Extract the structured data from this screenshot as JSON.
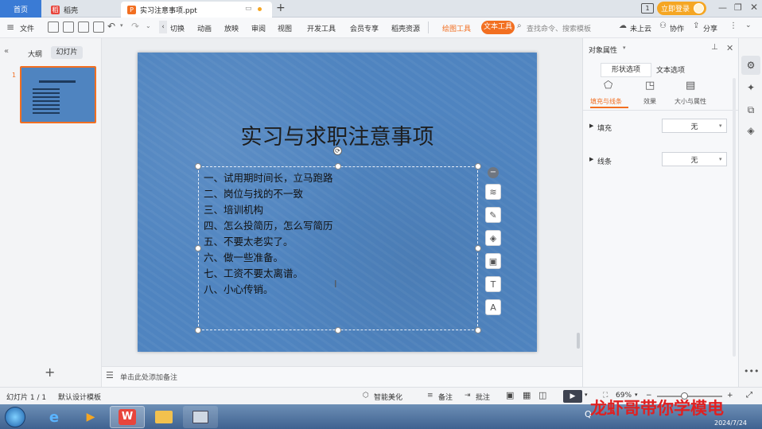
{
  "titlebar": {
    "tabs": [
      {
        "label": "首页"
      },
      {
        "label": "稻壳",
        "icon": "daoke-icon"
      },
      {
        "label": "实习注意事项.ppt",
        "icon": "ppt-icon"
      }
    ],
    "new_tab": "+",
    "window_badge": "1",
    "login_button": "立即登录"
  },
  "menubar": {
    "file": "文件",
    "items": [
      "切换",
      "动画",
      "放映",
      "审阅",
      "视图",
      "开发工具",
      "会员专享",
      "稻壳资源"
    ],
    "drawing_tools": "绘图工具",
    "text_tools": "文本工具",
    "search_placeholder": "查找命令、搜索模板",
    "cloud": "未上云",
    "collab": "协作",
    "share": "分享"
  },
  "leftpanel": {
    "tab_outline": "大纲",
    "tab_slides": "幻灯片",
    "slide_number": "1",
    "add_label": "+"
  },
  "slide": {
    "title": "实习与求职注意事项",
    "bullets": [
      "一、试用期时间长，立马跑路",
      "二、岗位与找的不一致",
      "三、培训机构",
      "四、怎么投简历，怎么写简历",
      "五、不要太老实了。",
      "六、做一些准备。",
      "七、工资不要太离谱。",
      "八、小心传销。"
    ]
  },
  "notes": {
    "placeholder": "单击此处添加备注"
  },
  "rightpanel": {
    "title": "对象属性",
    "tab_shape": "形状选项",
    "tab_text": "文本选项",
    "sub_fill_line": "填充与线条",
    "sub_effects": "效果",
    "sub_size": "大小与属性",
    "fill_label": "填充",
    "fill_value": "无",
    "line_label": "线条",
    "line_value": "无"
  },
  "statusbar": {
    "slide_count": "幻灯片 1 / 1",
    "template": "默认设计模板",
    "smart_beautify": "智能美化",
    "notes": "备注",
    "comments": "批注",
    "zoom": "69%"
  },
  "taskbar": {
    "date": "2024/7/24"
  },
  "watermark": "龙虾哥带你学模电",
  "colors": {
    "accent_blue": "#3a7bd5",
    "orange": "#f5a623",
    "slide_bg": "#4f84c0",
    "text_tools_bg": "#f26f21"
  }
}
